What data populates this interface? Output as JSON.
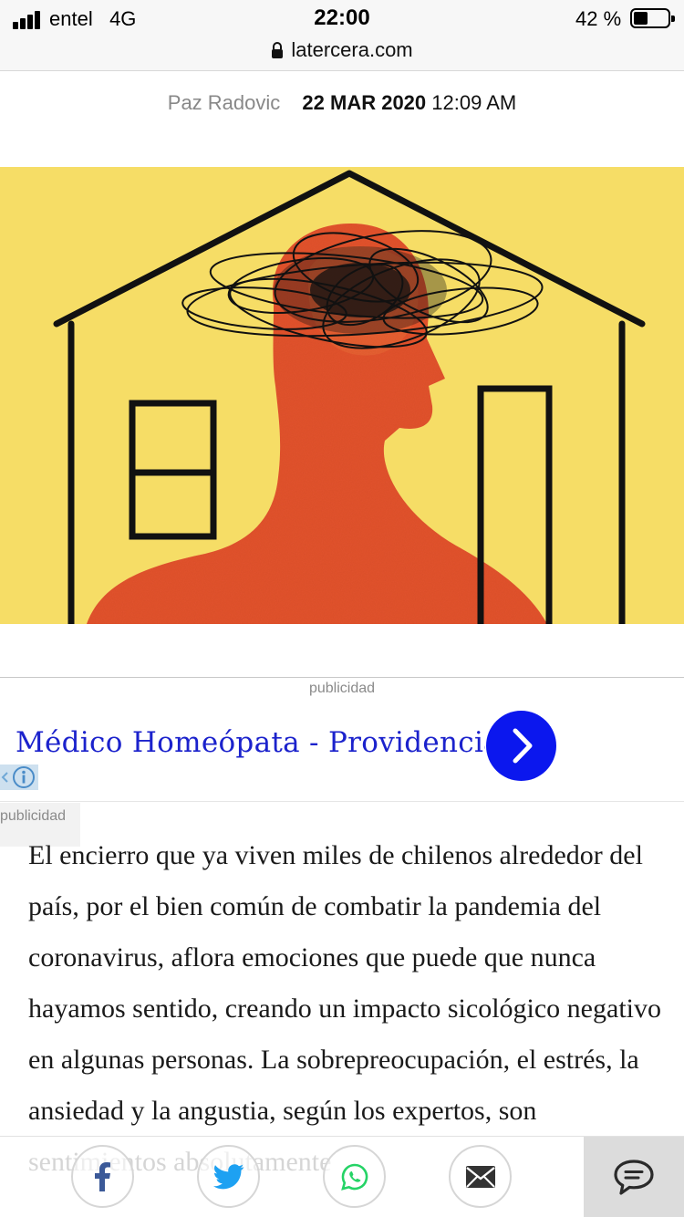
{
  "status_bar": {
    "carrier": "entel",
    "network": "4G",
    "time": "22:00",
    "battery_percent": "42 %",
    "battery_level": 0.42,
    "url": "latercera.com"
  },
  "byline": {
    "author": "Paz Radovic",
    "date": "22 MAR 2020",
    "time": "12:09 AM"
  },
  "hero_image": {
    "background_color": "#f6dd66",
    "figure_color": "#e2522d",
    "line_color": "#111111"
  },
  "ad": {
    "label": "publicidad",
    "title": "Médico Homeópata - Providencia",
    "label_bottom": "publicidad",
    "accent_color": "#0b17ee"
  },
  "article": {
    "text": "El encierro que ya viven miles de chilenos alrededor del país, por el bien común de combatir la pandemia del coronavirus, aflora emociones que puede que nunca hayamos sentido, creando un impacto sicológico negativo en algunas personas. La sobrepreocupación, el estrés, la ansiedad y la angustia, según los expertos, son sentimientos absolutamente"
  },
  "share_bar": {
    "buttons": [
      {
        "icon": "facebook-icon",
        "color": "#3b5998"
      },
      {
        "icon": "twitter-icon",
        "color": "#1da1f2"
      },
      {
        "icon": "whatsapp-icon",
        "color": "#25d366"
      },
      {
        "icon": "mail-icon",
        "color": "#333333"
      }
    ],
    "comment_icon": "comment-icon"
  }
}
